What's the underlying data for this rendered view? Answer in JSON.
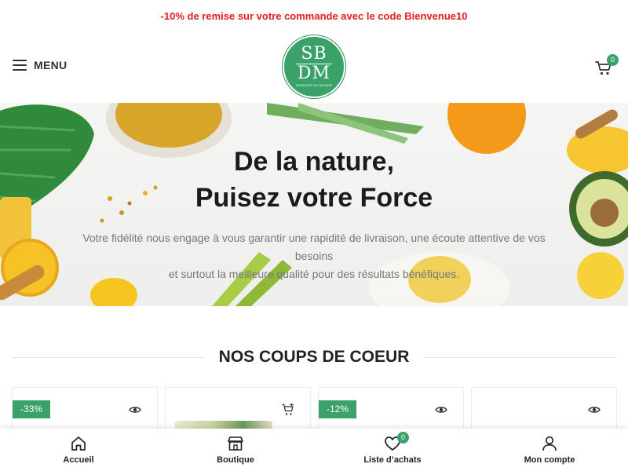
{
  "promo": {
    "text": "-10% de remise sur votre commande avec le code Bienvenue10"
  },
  "header": {
    "menu_label": "MENU",
    "logo": {
      "line1": "SB",
      "line2": "DM",
      "tagline": "SAVEURS DU MONDE"
    },
    "cart_count": "0"
  },
  "hero": {
    "title_line1": "De la nature,",
    "title_line2": "Puisez votre Force",
    "text_line1": "Votre fidélité nous engage à vous garantir une rapidité de livraison, une écoute attentive de vos besoins",
    "text_line2": "et surtout la meilleure qualité pour des résultats bénéfiques."
  },
  "section": {
    "title": "NOS COUPS DE COEUR"
  },
  "products": [
    {
      "badge": "-33%",
      "icon": "eye-icon"
    },
    {
      "badge": "",
      "icon": "add-to-cart-icon"
    },
    {
      "badge": "-12%",
      "icon": "eye-icon"
    },
    {
      "badge": "",
      "icon": "eye-icon"
    }
  ],
  "bottom_nav": {
    "home": "Accueil",
    "shop": "Boutique",
    "wishlist": "Liste d’achats",
    "wishlist_count": "0",
    "account": "Mon compte"
  },
  "colors": {
    "accent": "#3aa169",
    "promo": "#e31d1a"
  }
}
